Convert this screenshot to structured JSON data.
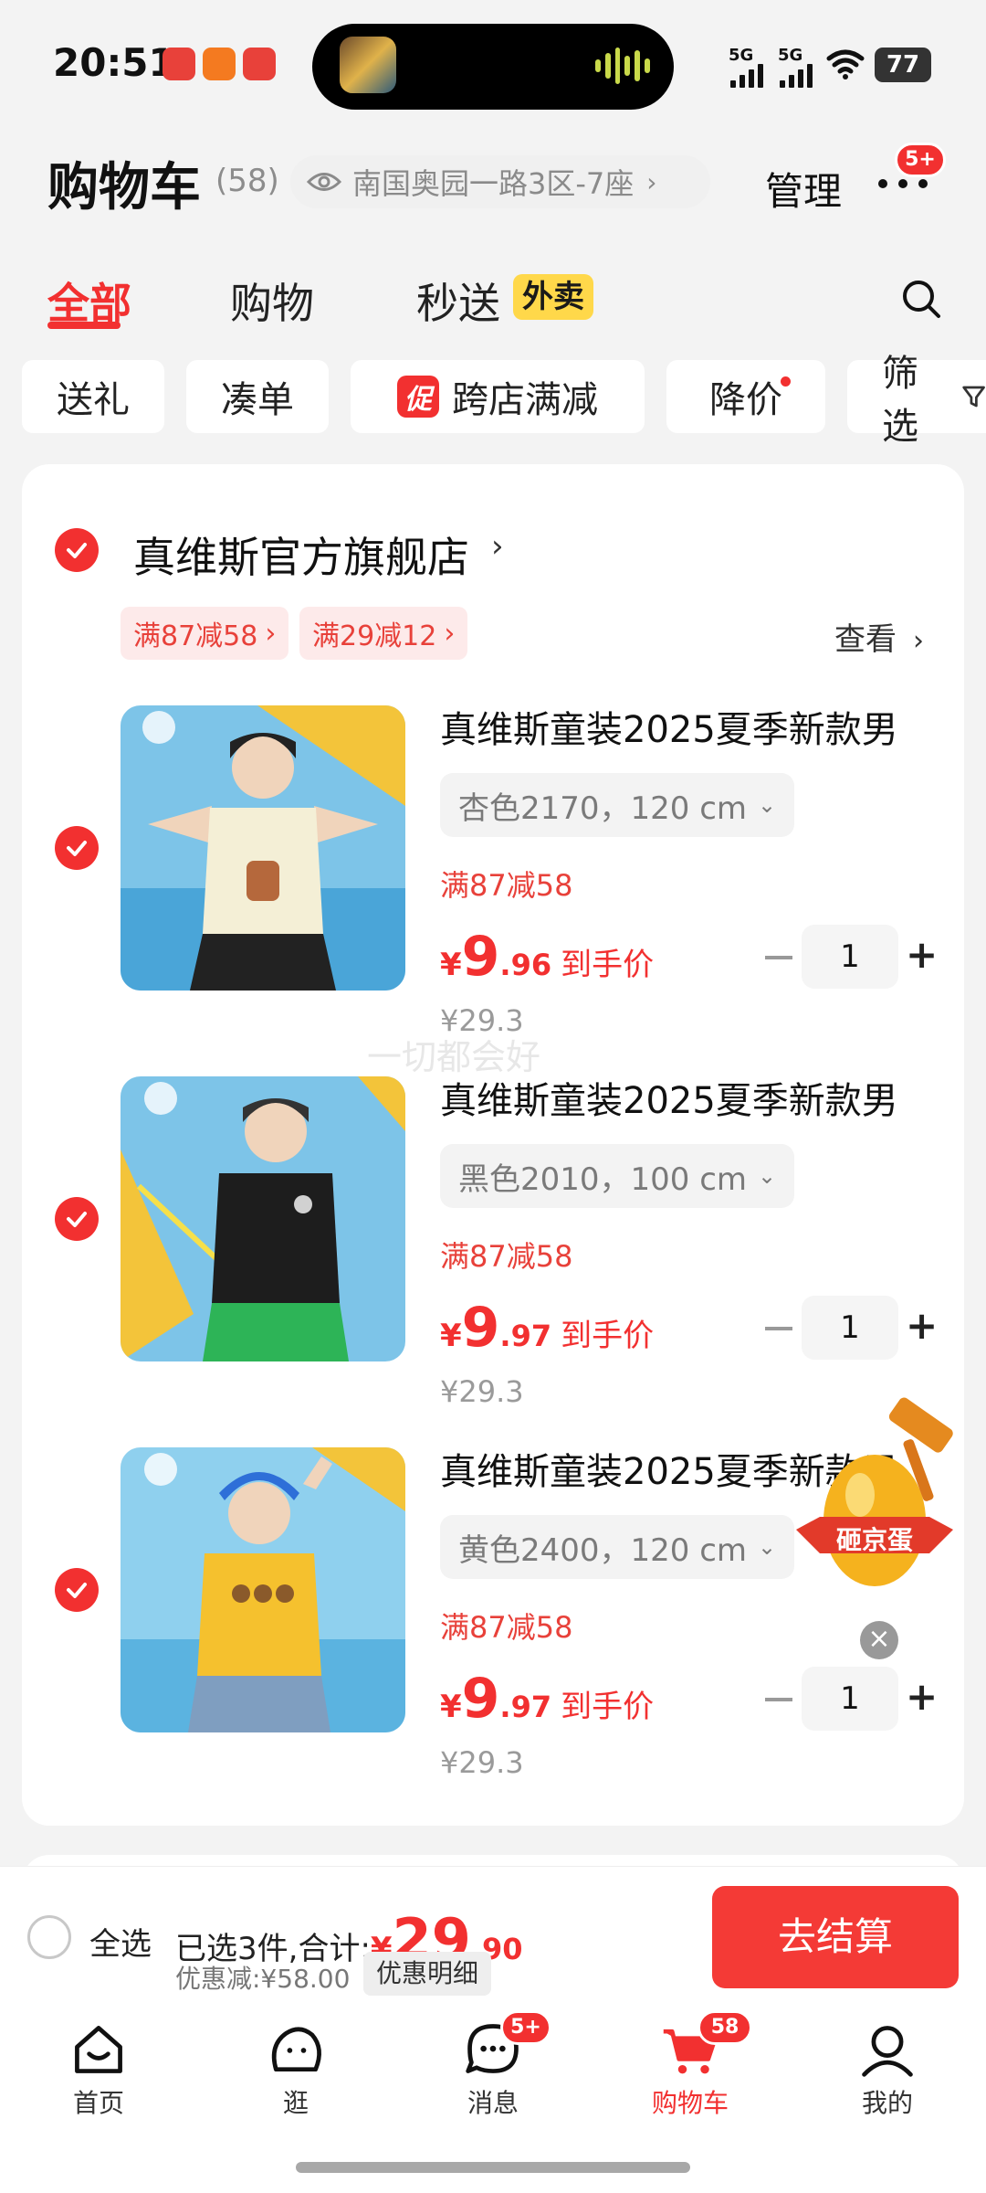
{
  "status_bar": {
    "time": "20:51",
    "network_1": "5G",
    "network_2": "5G",
    "battery": "77",
    "icons": [
      "jd-app-icon",
      "taobao-app-icon",
      "jd-app-icon",
      "wifi-icon",
      "battery-icon"
    ]
  },
  "header": {
    "title": "购物车",
    "count": "(58)",
    "address": "南国奥园一路3区-7座",
    "manage": "管理",
    "more_badge": "5+"
  },
  "tabs": [
    {
      "label": "全部",
      "active": true
    },
    {
      "label": "购物",
      "active": false
    },
    {
      "label": "秒送",
      "active": false
    }
  ],
  "takeaway_tag": "外卖",
  "chips": {
    "gift": "送礼",
    "bundle": "凑单",
    "promo_icon": "促",
    "cross_store": "跨店满减",
    "price_drop": "降价",
    "filter": "筛选"
  },
  "shop": {
    "name": "真维斯官方旗舰店",
    "coupons": [
      "满87减58",
      "满29减12"
    ],
    "view": "查看"
  },
  "items": [
    {
      "name": "真维斯童装2025夏季新款男",
      "spec": "杏色2170，120 cm",
      "promo": "满87减58",
      "price_symbol": "¥",
      "price_int": "9",
      "price_dec": ".96",
      "price_tag": "到手价",
      "original": "¥29.3",
      "qty": "1",
      "shirt_color": "#f4efd6"
    },
    {
      "name": "真维斯童装2025夏季新款男",
      "spec": "黑色2010，100 cm",
      "promo": "满87减58",
      "price_symbol": "¥",
      "price_int": "9",
      "price_dec": ".97",
      "price_tag": "到手价",
      "original": "¥29.3",
      "qty": "1",
      "shirt_color": "#1d1d1d"
    },
    {
      "name": "真维斯童装2025夏季新款男",
      "spec": "黄色2400，120 cm",
      "promo": "满87减58",
      "price_symbol": "¥",
      "price_int": "9",
      "price_dec": ".97",
      "price_tag": "到手价",
      "original": "¥29.3",
      "qty": "1",
      "shirt_color": "#f5c12e"
    }
  ],
  "watermark": "一切都会好",
  "float_banner": {
    "label": "砸京蛋"
  },
  "footer": {
    "select_all": "全选",
    "selected_prefix": "已选3件,合计:",
    "total_symbol": "¥",
    "total_int": "29",
    "total_dec": ".90",
    "discount": "优惠减:¥58.00",
    "discount_detail": "优惠明细",
    "checkout": "去结算"
  },
  "nav": [
    {
      "label": "首页",
      "icon": "home-icon",
      "active": false
    },
    {
      "label": "逛",
      "icon": "browse-icon",
      "active": false
    },
    {
      "label": "消息",
      "icon": "message-icon",
      "active": false,
      "badge": "5+"
    },
    {
      "label": "购物车",
      "icon": "cart-icon",
      "active": true,
      "badge": "58"
    },
    {
      "label": "我的",
      "icon": "profile-icon",
      "active": false
    }
  ],
  "colors": {
    "accent": "#f23030",
    "takeaway": "#ffd84a",
    "background": "#f3f3f3"
  }
}
